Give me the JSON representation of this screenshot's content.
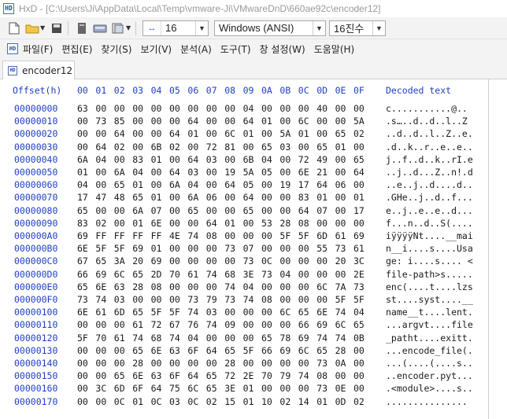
{
  "window": {
    "app": "HxD",
    "title": "HxD - [C:\\Users\\Ji\\AppData\\Local\\Temp\\vmware-Ji\\VMwareDnD\\660ae92c\\encoder12]"
  },
  "toolbar": {
    "bytes_per_row": "16",
    "charset": "Windows (ANSI)",
    "offset_base": "16진수"
  },
  "menu": [
    "파일(F)",
    "편집(E)",
    "찾기(S)",
    "보기(V)",
    "분석(A)",
    "도구(T)",
    "창 설정(W)",
    "도움말(H)"
  ],
  "tab": {
    "label": "encoder12"
  },
  "hex": {
    "offset_header": "Offset(h)",
    "columns": [
      "00",
      "01",
      "02",
      "03",
      "04",
      "05",
      "06",
      "07",
      "08",
      "09",
      "0A",
      "0B",
      "0C",
      "0D",
      "0E",
      "0F"
    ],
    "decoded_header": "Decoded text",
    "rows": [
      {
        "offset": "00000000",
        "bytes": [
          "63",
          "00",
          "00",
          "00",
          "00",
          "00",
          "00",
          "00",
          "00",
          "04",
          "00",
          "00",
          "00",
          "40",
          "00",
          "00"
        ],
        "text": "c...........@.."
      },
      {
        "offset": "00000010",
        "bytes": [
          "00",
          "73",
          "85",
          "00",
          "00",
          "00",
          "64",
          "00",
          "00",
          "64",
          "01",
          "00",
          "6C",
          "00",
          "00",
          "5A"
        ],
        "text": ".s…..d..d..l..Z"
      },
      {
        "offset": "00000020",
        "bytes": [
          "00",
          "00",
          "64",
          "00",
          "00",
          "64",
          "01",
          "00",
          "6C",
          "01",
          "00",
          "5A",
          "01",
          "00",
          "65",
          "02"
        ],
        "text": "..d..d..l..Z..e."
      },
      {
        "offset": "00000030",
        "bytes": [
          "00",
          "64",
          "02",
          "00",
          "6B",
          "02",
          "00",
          "72",
          "81",
          "00",
          "65",
          "03",
          "00",
          "65",
          "01",
          "00"
        ],
        "text": ".d..k..r..e..e.."
      },
      {
        "offset": "00000040",
        "bytes": [
          "6A",
          "04",
          "00",
          "83",
          "01",
          "00",
          "64",
          "03",
          "00",
          "6B",
          "04",
          "00",
          "72",
          "49",
          "00",
          "65"
        ],
        "text": "j..f..d..k..rI.e"
      },
      {
        "offset": "00000050",
        "bytes": [
          "01",
          "00",
          "6A",
          "04",
          "00",
          "64",
          "03",
          "00",
          "19",
          "5A",
          "05",
          "00",
          "6E",
          "21",
          "00",
          "64"
        ],
        "text": "..j..d...Z..n!.d"
      },
      {
        "offset": "00000060",
        "bytes": [
          "04",
          "00",
          "65",
          "01",
          "00",
          "6A",
          "04",
          "00",
          "64",
          "05",
          "00",
          "19",
          "17",
          "64",
          "06",
          "00"
        ],
        "text": "..e..j..d....d.."
      },
      {
        "offset": "00000070",
        "bytes": [
          "17",
          "47",
          "48",
          "65",
          "01",
          "00",
          "6A",
          "06",
          "00",
          "64",
          "00",
          "00",
          "83",
          "01",
          "00",
          "01"
        ],
        "text": ".GHe..j..d..f..."
      },
      {
        "offset": "00000080",
        "bytes": [
          "65",
          "00",
          "00",
          "6A",
          "07",
          "00",
          "65",
          "00",
          "00",
          "65",
          "00",
          "00",
          "64",
          "07",
          "00",
          "17"
        ],
        "text": "e..j..e..e..d..."
      },
      {
        "offset": "00000090",
        "bytes": [
          "83",
          "02",
          "00",
          "01",
          "6E",
          "00",
          "00",
          "64",
          "01",
          "00",
          "53",
          "28",
          "08",
          "00",
          "00",
          "00"
        ],
        "text": "f...n..d..S(...."
      },
      {
        "offset": "000000A0",
        "bytes": [
          "69",
          "FF",
          "FF",
          "FF",
          "FF",
          "4E",
          "74",
          "08",
          "00",
          "00",
          "00",
          "5F",
          "5F",
          "6D",
          "61",
          "69"
        ],
        "text": "iÿÿÿÿNt....__mai"
      },
      {
        "offset": "000000B0",
        "bytes": [
          "6E",
          "5F",
          "5F",
          "69",
          "01",
          "00",
          "00",
          "00",
          "73",
          "07",
          "00",
          "00",
          "00",
          "55",
          "73",
          "61"
        ],
        "text": "n__i....s....Usa"
      },
      {
        "offset": "000000C0",
        "bytes": [
          "67",
          "65",
          "3A",
          "20",
          "69",
          "00",
          "00",
          "00",
          "00",
          "73",
          "0C",
          "00",
          "00",
          "00",
          "20",
          "3C"
        ],
        "text": "ge: i....s.... <"
      },
      {
        "offset": "000000D0",
        "bytes": [
          "66",
          "69",
          "6C",
          "65",
          "2D",
          "70",
          "61",
          "74",
          "68",
          "3E",
          "73",
          "04",
          "00",
          "00",
          "00",
          "2E"
        ],
        "text": "file-path>s....."
      },
      {
        "offset": "000000E0",
        "bytes": [
          "65",
          "6E",
          "63",
          "28",
          "08",
          "00",
          "00",
          "00",
          "74",
          "04",
          "00",
          "00",
          "00",
          "6C",
          "7A",
          "73"
        ],
        "text": "enc(....t....lzs"
      },
      {
        "offset": "000000F0",
        "bytes": [
          "73",
          "74",
          "03",
          "00",
          "00",
          "00",
          "73",
          "79",
          "73",
          "74",
          "08",
          "00",
          "00",
          "00",
          "5F",
          "5F"
        ],
        "text": "st....syst....__"
      },
      {
        "offset": "00000100",
        "bytes": [
          "6E",
          "61",
          "6D",
          "65",
          "5F",
          "5F",
          "74",
          "03",
          "00",
          "00",
          "00",
          "6C",
          "65",
          "6E",
          "74",
          "04"
        ],
        "text": "name__t....lent."
      },
      {
        "offset": "00000110",
        "bytes": [
          "00",
          "00",
          "00",
          "61",
          "72",
          "67",
          "76",
          "74",
          "09",
          "00",
          "00",
          "00",
          "66",
          "69",
          "6C",
          "65"
        ],
        "text": "...argvt....file"
      },
      {
        "offset": "00000120",
        "bytes": [
          "5F",
          "70",
          "61",
          "74",
          "68",
          "74",
          "04",
          "00",
          "00",
          "00",
          "65",
          "78",
          "69",
          "74",
          "74",
          "0B"
        ],
        "text": "_patht....exitt."
      },
      {
        "offset": "00000130",
        "bytes": [
          "00",
          "00",
          "00",
          "65",
          "6E",
          "63",
          "6F",
          "64",
          "65",
          "5F",
          "66",
          "69",
          "6C",
          "65",
          "28",
          "00"
        ],
        "text": "...encode_file(."
      },
      {
        "offset": "00000140",
        "bytes": [
          "00",
          "00",
          "00",
          "28",
          "00",
          "00",
          "00",
          "00",
          "28",
          "00",
          "00",
          "00",
          "00",
          "73",
          "0A",
          "00"
        ],
        "text": "...(....(....s.."
      },
      {
        "offset": "00000150",
        "bytes": [
          "00",
          "00",
          "65",
          "6E",
          "63",
          "6F",
          "64",
          "65",
          "72",
          "2E",
          "70",
          "79",
          "74",
          "08",
          "00",
          "00"
        ],
        "text": "..encoder.pyt..."
      },
      {
        "offset": "00000160",
        "bytes": [
          "00",
          "3C",
          "6D",
          "6F",
          "64",
          "75",
          "6C",
          "65",
          "3E",
          "01",
          "00",
          "00",
          "00",
          "73",
          "0E",
          "00"
        ],
        "text": ".<module>....s.."
      },
      {
        "offset": "00000170",
        "bytes": [
          "00",
          "00",
          "0C",
          "01",
          "0C",
          "03",
          "0C",
          "02",
          "15",
          "01",
          "10",
          "02",
          "14",
          "01",
          "0D",
          "02"
        ],
        "text": "..............."
      }
    ]
  }
}
